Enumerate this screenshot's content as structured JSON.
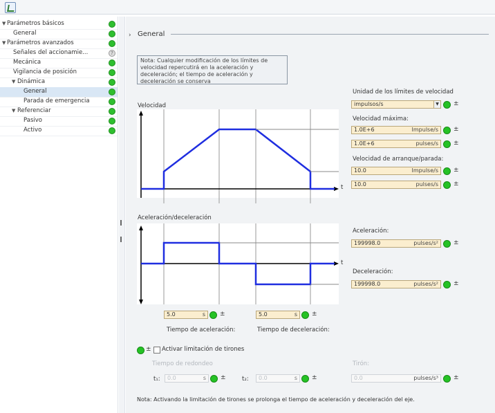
{
  "tree": {
    "items": [
      {
        "label": "Parámetros básicos",
        "expanded": true,
        "status": "ok"
      },
      {
        "label": "General",
        "status": "ok"
      },
      {
        "label": "Parámetros avanzados",
        "expanded": true,
        "status": "ok"
      },
      {
        "label": "Señales del accionamie...",
        "status": "unknown"
      },
      {
        "label": "Mecánica",
        "status": "ok"
      },
      {
        "label": "Vigilancia de posición",
        "status": "ok"
      },
      {
        "label": "Dinámica",
        "expanded": true,
        "status": "ok"
      },
      {
        "label": "General",
        "selected": true,
        "status": "ok"
      },
      {
        "label": "Parada de emergencia",
        "status": "ok"
      },
      {
        "label": "Referenciar",
        "expanded": true,
        "status": "ok"
      },
      {
        "label": "Pasivo",
        "status": "ok"
      },
      {
        "label": "Activo",
        "status": "ok"
      }
    ]
  },
  "section": {
    "title": "General"
  },
  "note_top": "Nota: Cualquier modificación de los límites de velocidad repercutirá en la aceleración y deceleración; el tiempo de aceleración y deceleración se conserva",
  "velocity_graph": {
    "label": "Velocidad",
    "axis_t": "t"
  },
  "accel_graph": {
    "label": "Aceleración/deceleración",
    "axis_t": "t"
  },
  "velocity_limits": {
    "unit_label": "Unidad de los límites de velocidad",
    "unit_value": "impulsos/s",
    "max_label": "Velocidad máxima:",
    "max_value_1": "1.0E+6",
    "max_unit_1": "Impulse/s",
    "max_value_2": "1.0E+6",
    "max_unit_2": "pulses/s",
    "startstop_label": "Velocidad de arranque/parada:",
    "ss_value_1": "10.0",
    "ss_unit_1": "Impulse/s",
    "ss_value_2": "10.0",
    "ss_unit_2": "pulses/s"
  },
  "acceleration": {
    "accel_label": "Aceleración:",
    "accel_value": "199998.0",
    "accel_unit": "pulses/s²",
    "decel_label": "Deceleración:",
    "decel_value": "199998.0",
    "decel_unit": "pulses/s²"
  },
  "times": {
    "accel_time_value": "5.0",
    "accel_time_unit": "s",
    "accel_time_label": "Tiempo de aceleración:",
    "decel_time_value": "5.0",
    "decel_time_unit": "s",
    "decel_time_label": "Tiempo de deceleración:"
  },
  "jerk": {
    "checkbox_label": "Activar limitación de tirones",
    "checked": false,
    "smoothing_label": "Tiempo de redondeo",
    "t1_label": "t₁:",
    "t1_value": "0.0",
    "t1_unit": "s",
    "t2_label": "t₂:",
    "t2_value": "0.0",
    "t2_unit": "s",
    "jerk_label": "Tirón:",
    "jerk_value": "0.0",
    "jerk_unit": "pulses/s³"
  },
  "note_bottom": "Nota: Activando la limitación de tirones se prolonga el tiempo de aceleración y deceleración del eje.",
  "colors": {
    "status_ok": "#25c225",
    "field_bg": "#fbeecf",
    "graph_line": "#1f2ee0"
  }
}
